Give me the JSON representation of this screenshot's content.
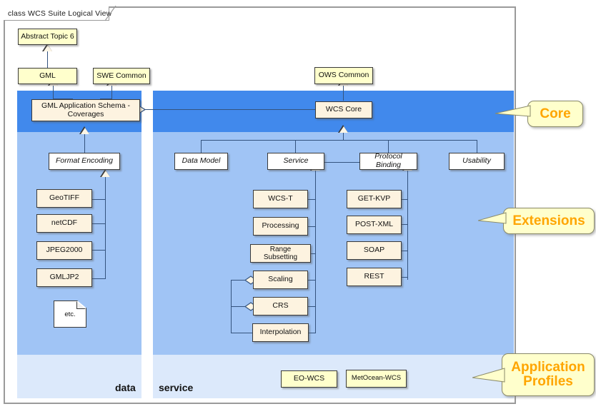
{
  "diagram": {
    "title": "class WCS Suite Logical View",
    "captions": {
      "data": "data",
      "service": "service"
    },
    "colors": {
      "core_band": "#4189EC",
      "extensions_band": "#A0C4F5",
      "profiles_band": "#DCE9FB",
      "class_cream": "#FDF3E0",
      "class_yellow": "#FFFFCC",
      "class_white": "#FFFFFF",
      "connector": "#34537E",
      "callout_text": "#FFA500",
      "frame": "#9A9A9A"
    }
  },
  "external_classes": [
    {
      "id": "abstract-topic-6",
      "label": "Abstract Topic 6"
    },
    {
      "id": "gml",
      "label": "GML"
    },
    {
      "id": "swe-common",
      "label": "SWE Common"
    },
    {
      "id": "ows-common",
      "label": "OWS Common"
    }
  ],
  "core": {
    "data_class": {
      "id": "gml-app-schema-coverages",
      "line1": "GML Application  Schema -",
      "line2": "Coverages"
    },
    "service_class": {
      "id": "wcs-core",
      "label": "WCS Core"
    }
  },
  "extensions": {
    "data_abstract": {
      "id": "format-encoding",
      "label": "Format Encoding"
    },
    "data_items": [
      {
        "id": "geotiff",
        "label": "GeoTIFF"
      },
      {
        "id": "netcdf",
        "label": "netCDF"
      },
      {
        "id": "jpeg2000",
        "label": "JPEG2000"
      },
      {
        "id": "gmljp2",
        "label": "GMLJP2"
      }
    ],
    "data_note": {
      "id": "etc-note",
      "label": "etc."
    },
    "service_abstracts": [
      {
        "id": "data-model",
        "label": "Data Model"
      },
      {
        "id": "service",
        "label": "Service"
      },
      {
        "id": "protocol-binding",
        "label": "Protocol Binding"
      },
      {
        "id": "usability",
        "label": "Usability"
      }
    ],
    "service_items": [
      {
        "id": "wcs-t",
        "label": "WCS-T"
      },
      {
        "id": "processing",
        "label": "Processing"
      },
      {
        "id": "range-subsetting",
        "label": "Range Subsetting"
      },
      {
        "id": "scaling",
        "label": "Scaling"
      },
      {
        "id": "crs",
        "label": "CRS"
      },
      {
        "id": "interpolation",
        "label": "Interpolation"
      }
    ],
    "binding_items": [
      {
        "id": "get-kvp",
        "label": "GET-KVP"
      },
      {
        "id": "post-xml",
        "label": "POST-XML"
      },
      {
        "id": "soap",
        "label": "SOAP"
      },
      {
        "id": "rest",
        "label": "REST"
      }
    ]
  },
  "application_profiles": [
    {
      "id": "eo-wcs",
      "label": "EO-WCS"
    },
    {
      "id": "metocean-wcs",
      "label": "MetOcean-WCS"
    }
  ],
  "callouts": {
    "core": "Core",
    "extensions": "Extensions",
    "profiles_line1": "Application",
    "profiles_line2": "Profiles"
  }
}
